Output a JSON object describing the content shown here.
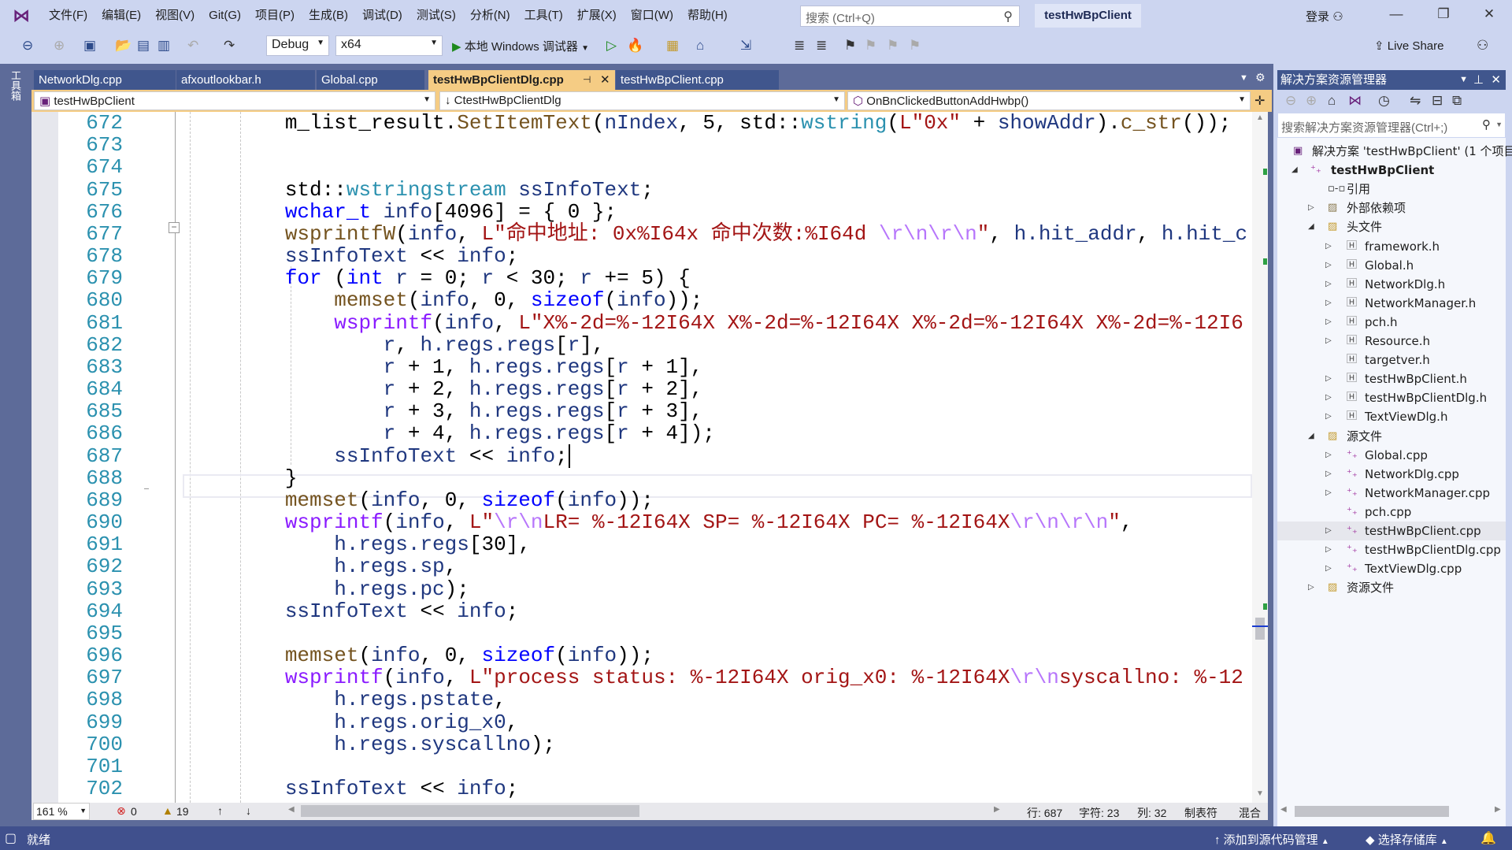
{
  "titlebar": {
    "menu": [
      "文件(F)",
      "编辑(E)",
      "视图(V)",
      "Git(G)",
      "项目(P)",
      "生成(B)",
      "调试(D)",
      "测试(S)",
      "分析(N)",
      "工具(T)",
      "扩展(X)",
      "窗口(W)",
      "帮助(H)"
    ],
    "search_placeholder": "搜索 (Ctrl+Q)",
    "solution_name": "testHwBpClient",
    "login": "登录"
  },
  "toolbar": {
    "config": "Debug",
    "platform": "x64",
    "run_label": "本地 Windows 调试器",
    "live_share": "Live Share"
  },
  "toolbox_label": "工具箱",
  "tabs": [
    {
      "label": "NetworkDlg.cpp",
      "active": false
    },
    {
      "label": "afxoutlookbar.h",
      "active": false
    },
    {
      "label": "Global.cpp",
      "active": false
    },
    {
      "label": "testHwBpClientDlg.cpp",
      "active": true
    },
    {
      "label": "testHwBpClient.cpp",
      "active": false
    }
  ],
  "navbar": {
    "project": "testHwBpClient",
    "class": "CtestHwBpClientDlg",
    "member": "OnBnClickedButtonAddHwbp()"
  },
  "code": {
    "current_line": 687,
    "lines": [
      {
        "n": "672",
        "t": [
          [
            "        m_list_result.",
            "p"
          ],
          [
            "SetItemText",
            "f"
          ],
          [
            "(",
            "p"
          ],
          [
            "nIndex",
            "v"
          ],
          [
            ", 5, std::",
            "p"
          ],
          [
            "wstring",
            "t"
          ],
          [
            "(",
            "p"
          ],
          [
            "L\"0x\"",
            "s"
          ],
          [
            " + ",
            "p"
          ],
          [
            "showAddr",
            "v"
          ],
          [
            ").",
            "p"
          ],
          [
            "c_str",
            "f"
          ],
          [
            "());",
            "p"
          ]
        ]
      },
      {
        "n": "673",
        "t": []
      },
      {
        "n": "674",
        "t": []
      },
      {
        "n": "675",
        "t": [
          [
            "        std::",
            "p"
          ],
          [
            "wstringstream",
            "t"
          ],
          [
            " ",
            "p"
          ],
          [
            "ssInfoText",
            "v"
          ],
          [
            ";",
            "p"
          ]
        ]
      },
      {
        "n": "676",
        "t": [
          [
            "        ",
            "p"
          ],
          [
            "wchar_t",
            "k"
          ],
          [
            " ",
            "p"
          ],
          [
            "info",
            "v"
          ],
          [
            "[4096] = { 0 };",
            "p"
          ]
        ]
      },
      {
        "n": "677",
        "t": [
          [
            "        ",
            "p"
          ],
          [
            "wsprintfW",
            "f"
          ],
          [
            "(",
            "p"
          ],
          [
            "info",
            "v"
          ],
          [
            ", ",
            "p"
          ],
          [
            "L\"命中地址: 0x%I64x 命中次数:%I64d ",
            "s"
          ],
          [
            "\\r\\n\\r\\n",
            "e"
          ],
          [
            "\"",
            "s"
          ],
          [
            ", ",
            "p"
          ],
          [
            "h.hit_addr",
            "v"
          ],
          [
            ", ",
            "p"
          ],
          [
            "h.hit_c",
            "v"
          ]
        ]
      },
      {
        "n": "678",
        "t": [
          [
            "        ",
            "p"
          ],
          [
            "ssInfoText",
            "v"
          ],
          [
            " << ",
            "p"
          ],
          [
            "info",
            "v"
          ],
          [
            ";",
            "p"
          ]
        ]
      },
      {
        "n": "679",
        "t": [
          [
            "        ",
            "p"
          ],
          [
            "for",
            "k"
          ],
          [
            " (",
            "p"
          ],
          [
            "int",
            "k"
          ],
          [
            " ",
            "p"
          ],
          [
            "r",
            "v"
          ],
          [
            " = 0; ",
            "p"
          ],
          [
            "r",
            "v"
          ],
          [
            " < 30; ",
            "p"
          ],
          [
            "r",
            "v"
          ],
          [
            " += 5) {",
            "p"
          ]
        ]
      },
      {
        "n": "680",
        "t": [
          [
            "            ",
            "p"
          ],
          [
            "memset",
            "f"
          ],
          [
            "(",
            "p"
          ],
          [
            "info",
            "v"
          ],
          [
            ", 0, ",
            "p"
          ],
          [
            "sizeof",
            "k"
          ],
          [
            "(",
            "p"
          ],
          [
            "info",
            "v"
          ],
          [
            "));",
            "p"
          ]
        ]
      },
      {
        "n": "681",
        "t": [
          [
            "            ",
            "p"
          ],
          [
            "wsprintf",
            "m"
          ],
          [
            "(",
            "p"
          ],
          [
            "info",
            "v"
          ],
          [
            ", ",
            "p"
          ],
          [
            "L\"X%-2d=%-12I64X X%-2d=%-12I64X X%-2d=%-12I64X X%-2d=%-12I6",
            "s"
          ]
        ]
      },
      {
        "n": "682",
        "t": [
          [
            "                ",
            "p"
          ],
          [
            "r",
            "v"
          ],
          [
            ", ",
            "p"
          ],
          [
            "h.regs.regs",
            "v"
          ],
          [
            "[",
            "p"
          ],
          [
            "r",
            "v"
          ],
          [
            "],",
            "p"
          ]
        ]
      },
      {
        "n": "683",
        "t": [
          [
            "                ",
            "p"
          ],
          [
            "r",
            "v"
          ],
          [
            " + 1, ",
            "p"
          ],
          [
            "h.regs.regs",
            "v"
          ],
          [
            "[",
            "p"
          ],
          [
            "r",
            "v"
          ],
          [
            " + 1],",
            "p"
          ]
        ]
      },
      {
        "n": "684",
        "t": [
          [
            "                ",
            "p"
          ],
          [
            "r",
            "v"
          ],
          [
            " + 2, ",
            "p"
          ],
          [
            "h.regs.regs",
            "v"
          ],
          [
            "[",
            "p"
          ],
          [
            "r",
            "v"
          ],
          [
            " + 2],",
            "p"
          ]
        ]
      },
      {
        "n": "685",
        "t": [
          [
            "                ",
            "p"
          ],
          [
            "r",
            "v"
          ],
          [
            " + 3, ",
            "p"
          ],
          [
            "h.regs.regs",
            "v"
          ],
          [
            "[",
            "p"
          ],
          [
            "r",
            "v"
          ],
          [
            " + 3],",
            "p"
          ]
        ]
      },
      {
        "n": "686",
        "t": [
          [
            "                ",
            "p"
          ],
          [
            "r",
            "v"
          ],
          [
            " + 4, ",
            "p"
          ],
          [
            "h.regs.regs",
            "v"
          ],
          [
            "[",
            "p"
          ],
          [
            "r",
            "v"
          ],
          [
            " + 4]);",
            "p"
          ]
        ]
      },
      {
        "n": "687",
        "t": [
          [
            "            ",
            "p"
          ],
          [
            "ssInfoText",
            "v"
          ],
          [
            " << ",
            "p"
          ],
          [
            "info",
            "v"
          ],
          [
            ";",
            "p"
          ]
        ]
      },
      {
        "n": "688",
        "t": [
          [
            "        }",
            "p"
          ]
        ]
      },
      {
        "n": "689",
        "t": [
          [
            "        ",
            "p"
          ],
          [
            "memset",
            "f"
          ],
          [
            "(",
            "p"
          ],
          [
            "info",
            "v"
          ],
          [
            ", 0, ",
            "p"
          ],
          [
            "sizeof",
            "k"
          ],
          [
            "(",
            "p"
          ],
          [
            "info",
            "v"
          ],
          [
            "));",
            "p"
          ]
        ]
      },
      {
        "n": "690",
        "t": [
          [
            "        ",
            "p"
          ],
          [
            "wsprintf",
            "m"
          ],
          [
            "(",
            "p"
          ],
          [
            "info",
            "v"
          ],
          [
            ", ",
            "p"
          ],
          [
            "L\"",
            "s"
          ],
          [
            "\\r\\n",
            "e"
          ],
          [
            "LR= %-12I64X SP= %-12I64X PC= %-12I64X",
            "s"
          ],
          [
            "\\r\\n\\r\\n",
            "e"
          ],
          [
            "\"",
            "s"
          ],
          [
            ",",
            "p"
          ]
        ]
      },
      {
        "n": "691",
        "t": [
          [
            "            ",
            "p"
          ],
          [
            "h.regs.regs",
            "v"
          ],
          [
            "[30],",
            "p"
          ]
        ]
      },
      {
        "n": "692",
        "t": [
          [
            "            ",
            "p"
          ],
          [
            "h.regs.sp",
            "v"
          ],
          [
            ",",
            "p"
          ]
        ]
      },
      {
        "n": "693",
        "t": [
          [
            "            ",
            "p"
          ],
          [
            "h.regs.pc",
            "v"
          ],
          [
            ");",
            "p"
          ]
        ]
      },
      {
        "n": "694",
        "t": [
          [
            "        ",
            "p"
          ],
          [
            "ssInfoText",
            "v"
          ],
          [
            " << ",
            "p"
          ],
          [
            "info",
            "v"
          ],
          [
            ";",
            "p"
          ]
        ]
      },
      {
        "n": "695",
        "t": []
      },
      {
        "n": "696",
        "t": [
          [
            "        ",
            "p"
          ],
          [
            "memset",
            "f"
          ],
          [
            "(",
            "p"
          ],
          [
            "info",
            "v"
          ],
          [
            ", 0, ",
            "p"
          ],
          [
            "sizeof",
            "k"
          ],
          [
            "(",
            "p"
          ],
          [
            "info",
            "v"
          ],
          [
            "));",
            "p"
          ]
        ]
      },
      {
        "n": "697",
        "t": [
          [
            "        ",
            "p"
          ],
          [
            "wsprintf",
            "m"
          ],
          [
            "(",
            "p"
          ],
          [
            "info",
            "v"
          ],
          [
            ", ",
            "p"
          ],
          [
            "L\"process status: %-12I64X orig_x0: %-12I64X",
            "s"
          ],
          [
            "\\r\\n",
            "e"
          ],
          [
            "syscallno: %-12",
            "s"
          ]
        ]
      },
      {
        "n": "698",
        "t": [
          [
            "            ",
            "p"
          ],
          [
            "h.regs.pstate",
            "v"
          ],
          [
            ",",
            "p"
          ]
        ]
      },
      {
        "n": "699",
        "t": [
          [
            "            ",
            "p"
          ],
          [
            "h.regs.orig_x0",
            "v"
          ],
          [
            ",",
            "p"
          ]
        ]
      },
      {
        "n": "700",
        "t": [
          [
            "            ",
            "p"
          ],
          [
            "h.regs.syscallno",
            "v"
          ],
          [
            ");",
            "p"
          ]
        ]
      },
      {
        "n": "701",
        "t": []
      },
      {
        "n": "702",
        "t": [
          [
            "        ",
            "p"
          ],
          [
            "ssInfoText",
            "v"
          ],
          [
            " << ",
            "p"
          ],
          [
            "info",
            "v"
          ],
          [
            ";",
            "p"
          ]
        ]
      }
    ]
  },
  "editor_status": {
    "zoom": "161 %",
    "errors": "0",
    "warnings": "19",
    "line": "行: 687",
    "char": "字符: 23",
    "col": "列: 32",
    "tabs": "制表符",
    "eol": "混合"
  },
  "solution_explorer": {
    "title": "解决方案资源管理器",
    "search_placeholder": "搜索解决方案资源管理器(Ctrl+;)",
    "items": [
      {
        "label": "解决方案 'testHwBpClient' (1 个项目",
        "level": 0,
        "icon": "solution-icon",
        "exp": "none"
      },
      {
        "label": "testHwBpClient",
        "level": 1,
        "icon": "project-icon",
        "exp": "expanded",
        "bold": true
      },
      {
        "label": "引用",
        "level": 2,
        "icon": "reference-icon",
        "exp": "none"
      },
      {
        "label": "外部依赖项",
        "level": 2,
        "icon": "external-deps-icon",
        "exp": "collapsed"
      },
      {
        "label": "头文件",
        "level": 2,
        "icon": "filter-folder-icon",
        "exp": "expanded"
      },
      {
        "label": "framework.h",
        "level": 3,
        "icon": "header-file-icon",
        "exp": "collapsed"
      },
      {
        "label": "Global.h",
        "level": 3,
        "icon": "header-file-icon",
        "exp": "collapsed"
      },
      {
        "label": "NetworkDlg.h",
        "level": 3,
        "icon": "header-file-icon",
        "exp": "collapsed"
      },
      {
        "label": "NetworkManager.h",
        "level": 3,
        "icon": "header-file-icon",
        "exp": "collapsed"
      },
      {
        "label": "pch.h",
        "level": 3,
        "icon": "header-file-icon",
        "exp": "collapsed"
      },
      {
        "label": "Resource.h",
        "level": 3,
        "icon": "header-file-icon",
        "exp": "collapsed"
      },
      {
        "label": "targetver.h",
        "level": 3,
        "icon": "header-file-icon",
        "exp": "none"
      },
      {
        "label": "testHwBpClient.h",
        "level": 3,
        "icon": "header-file-icon",
        "exp": "collapsed"
      },
      {
        "label": "testHwBpClientDlg.h",
        "level": 3,
        "icon": "header-file-icon",
        "exp": "collapsed"
      },
      {
        "label": "TextViewDlg.h",
        "level": 3,
        "icon": "header-file-icon",
        "exp": "collapsed"
      },
      {
        "label": "源文件",
        "level": 2,
        "icon": "filter-folder-icon",
        "exp": "expanded"
      },
      {
        "label": "Global.cpp",
        "level": 3,
        "icon": "cpp-file-icon",
        "exp": "collapsed"
      },
      {
        "label": "NetworkDlg.cpp",
        "level": 3,
        "icon": "cpp-file-icon",
        "exp": "collapsed"
      },
      {
        "label": "NetworkManager.cpp",
        "level": 3,
        "icon": "cpp-file-icon",
        "exp": "collapsed"
      },
      {
        "label": "pch.cpp",
        "level": 3,
        "icon": "cpp-file-icon",
        "exp": "none"
      },
      {
        "label": "testHwBpClient.cpp",
        "level": 3,
        "icon": "cpp-file-icon",
        "exp": "collapsed",
        "selected": true
      },
      {
        "label": "testHwBpClientDlg.cpp",
        "level": 3,
        "icon": "cpp-file-icon",
        "exp": "collapsed"
      },
      {
        "label": "TextViewDlg.cpp",
        "level": 3,
        "icon": "cpp-file-icon",
        "exp": "collapsed"
      },
      {
        "label": "资源文件",
        "level": 2,
        "icon": "filter-folder-icon",
        "exp": "collapsed"
      }
    ]
  },
  "statusbar": {
    "ready": "就绪",
    "add_source_control": "添加到源代码管理",
    "select_repo": "选择存储库"
  },
  "colors": {
    "accent_tab": "#f5cc84",
    "status_bar": "#40508d",
    "line_number": "#2b91af"
  }
}
